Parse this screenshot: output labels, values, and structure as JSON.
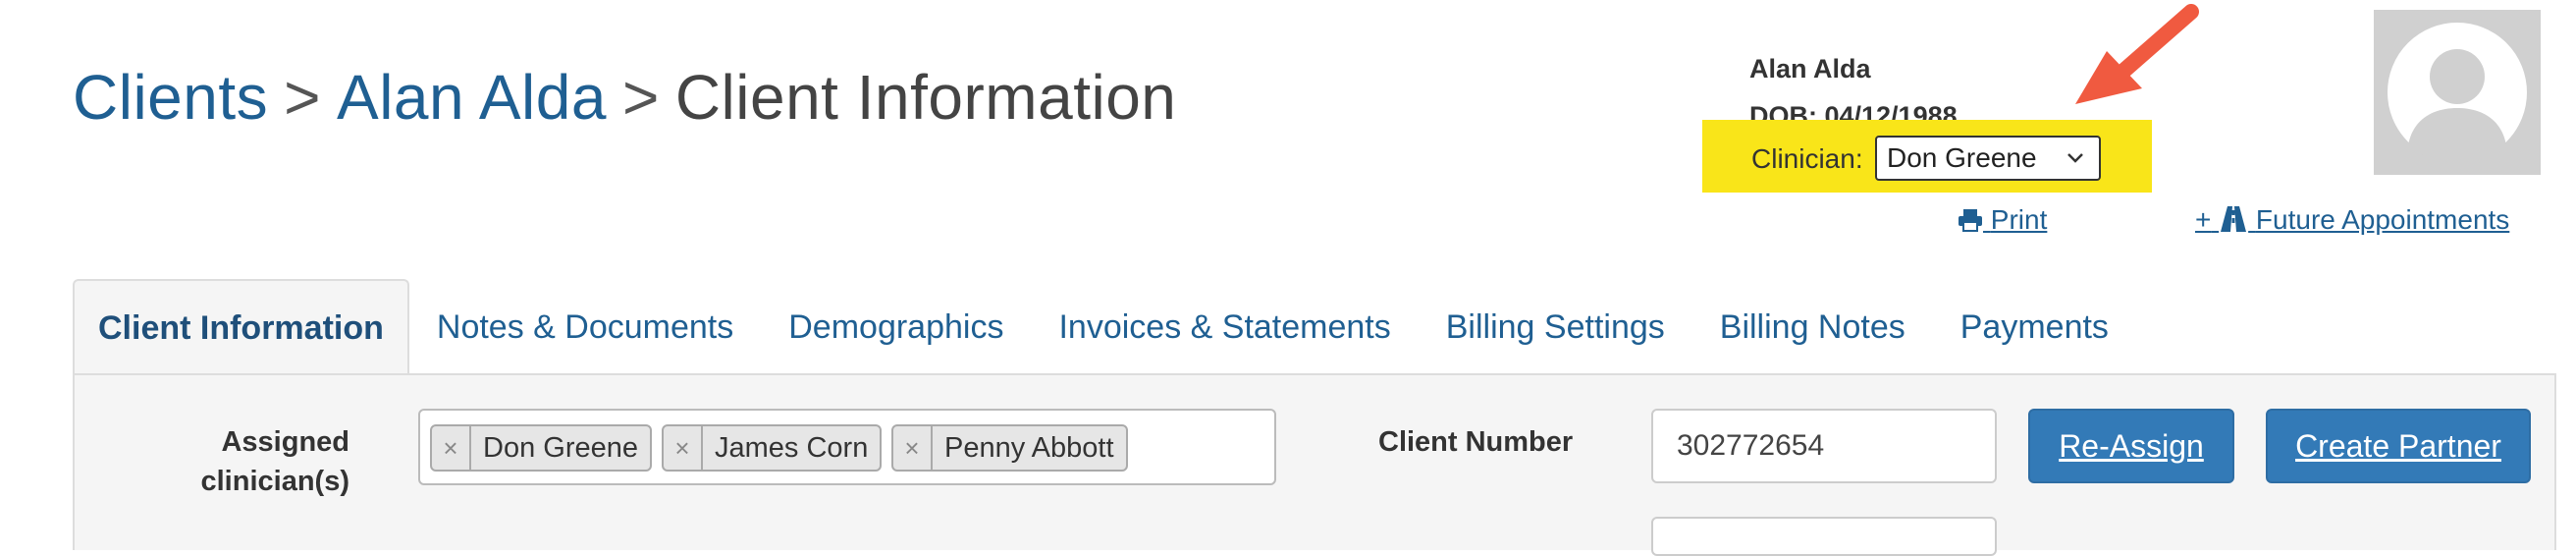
{
  "breadcrumb": {
    "clients": "Clients",
    "client_name": "Alan Alda",
    "current": "Client Information",
    "separator": ">"
  },
  "client_header": {
    "name": "Alan Alda",
    "dob": "DOB: 04/12/1988",
    "clinician_label": "Clinician:",
    "clinician_value": "Don Greene",
    "highlight_color": "#f9e519"
  },
  "actions": {
    "print": "Print",
    "future_appointments": "Future Appointments",
    "future_prefix": "+"
  },
  "tabs": [
    {
      "label": "Client Information",
      "active": true
    },
    {
      "label": "Notes & Documents",
      "active": false
    },
    {
      "label": "Demographics",
      "active": false
    },
    {
      "label": "Invoices & Statements",
      "active": false
    },
    {
      "label": "Billing Settings",
      "active": false
    },
    {
      "label": "Billing Notes",
      "active": false
    },
    {
      "label": "Payments",
      "active": false
    }
  ],
  "form": {
    "assigned_label_line1": "Assigned",
    "assigned_label_line2": "clinician(s)",
    "assigned_clinicians": [
      "Don Greene",
      "James Corn",
      "Penny Abbott"
    ],
    "tag_remove_glyph": "×",
    "client_number_label": "Client Number",
    "client_number_value": "302772654",
    "reassign_label": "Re-Assign",
    "create_partner_label": "Create Partner"
  },
  "colors": {
    "link": "#1f5f92",
    "button": "#337ab7",
    "arrow": "#f05a40"
  }
}
